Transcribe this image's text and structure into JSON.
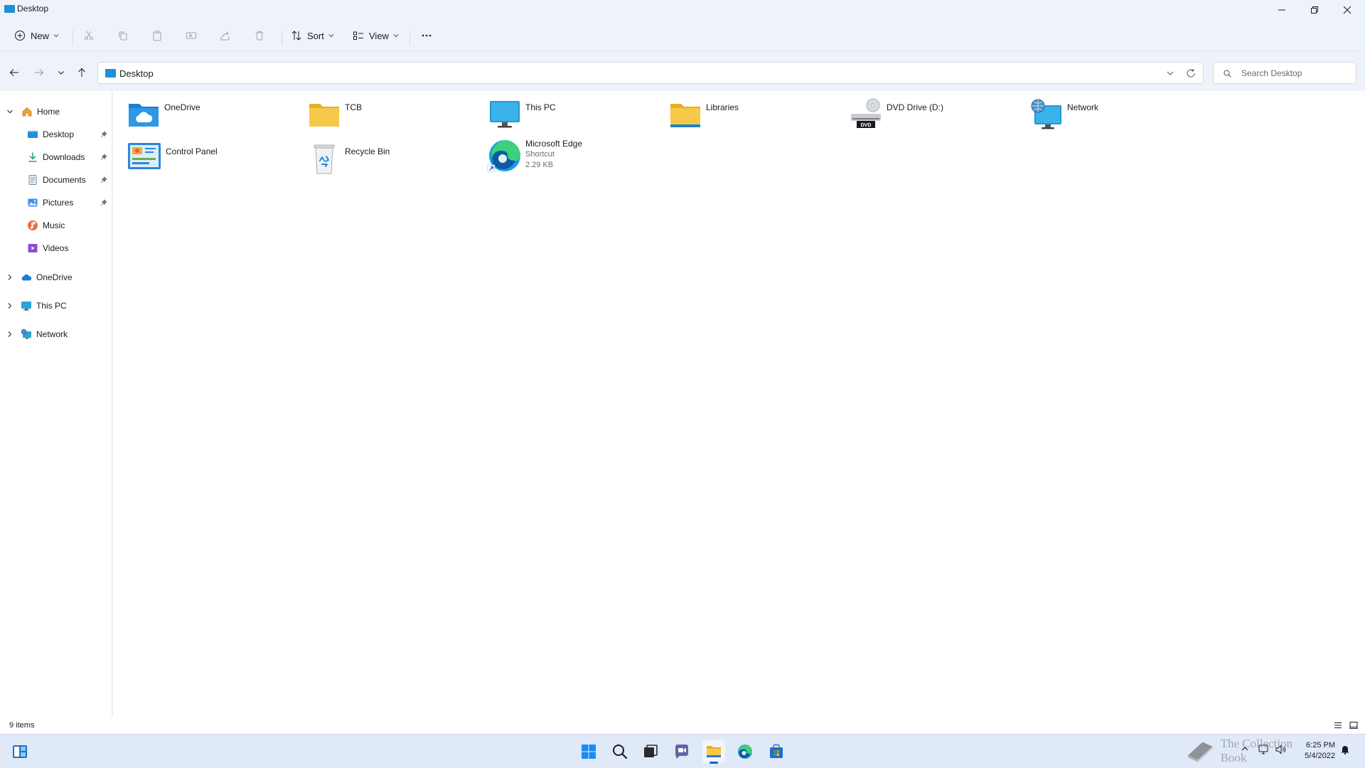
{
  "window": {
    "title": "Desktop"
  },
  "toolbar": {
    "new_label": "New",
    "sort_label": "Sort",
    "view_label": "View"
  },
  "address": {
    "path": "Desktop",
    "search_placeholder": "Search Desktop"
  },
  "sidebar": {
    "home": "Home",
    "quick_access": [
      {
        "label": "Desktop",
        "pinned": true
      },
      {
        "label": "Downloads",
        "pinned": true
      },
      {
        "label": "Documents",
        "pinned": true
      },
      {
        "label": "Pictures",
        "pinned": true
      },
      {
        "label": "Music",
        "pinned": false
      },
      {
        "label": "Videos",
        "pinned": false
      }
    ],
    "roots": [
      "OneDrive",
      "This PC",
      "Network"
    ]
  },
  "items": [
    {
      "name": "OneDrive",
      "icon": "onedrive-folder-icon"
    },
    {
      "name": "TCB",
      "icon": "folder-icon"
    },
    {
      "name": "This PC",
      "icon": "monitor-icon"
    },
    {
      "name": "Libraries",
      "icon": "libraries-folder-icon"
    },
    {
      "name": "DVD Drive (D:)",
      "icon": "dvd-drive-icon",
      "badge": "DVD"
    },
    {
      "name": "Network",
      "icon": "network-icon"
    },
    {
      "name": "Control Panel",
      "icon": "control-panel-icon"
    },
    {
      "name": "Recycle Bin",
      "icon": "recycle-bin-icon"
    },
    {
      "name": "Microsoft Edge",
      "icon": "edge-icon",
      "type": "Shortcut",
      "size": "2.29 KB"
    }
  ],
  "status": {
    "count": "9 items"
  },
  "taskbar": {
    "time": "6:25 PM",
    "date": "5/4/2022"
  },
  "watermark": {
    "text": "The Collection Book"
  },
  "colors": {
    "accent": "#0067c0",
    "folder": "#f7c948",
    "chrome": "#eef2f9"
  }
}
